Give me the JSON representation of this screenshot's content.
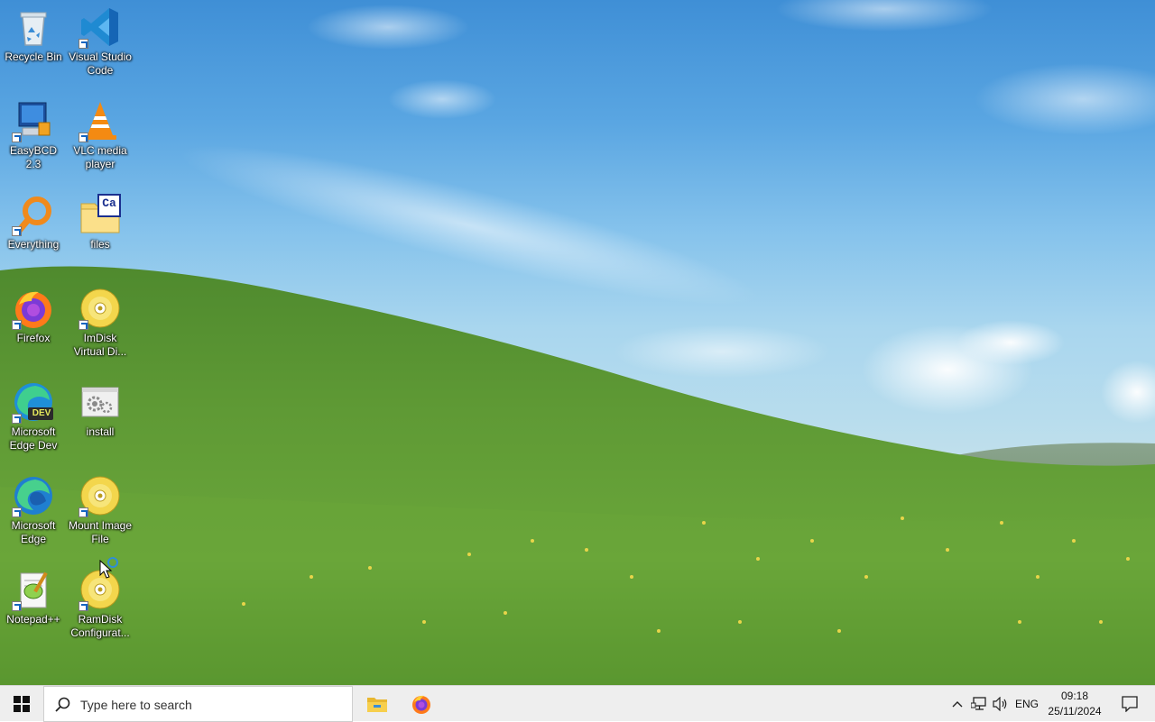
{
  "desktop": {
    "icons": [
      {
        "label": "Recycle Bin",
        "icon": "recycle-bin-icon"
      },
      {
        "label": "Visual Studio Code",
        "icon": "vscode-icon"
      },
      {
        "label": "EasyBCD 2.3",
        "icon": "easybcd-icon"
      },
      {
        "label": "VLC media player",
        "icon": "vlc-icon"
      },
      {
        "label": "Everything",
        "icon": "everything-search-icon"
      },
      {
        "label": "files",
        "icon": "folder-icon"
      },
      {
        "label": "Firefox",
        "icon": "firefox-icon"
      },
      {
        "label": "ImDisk Virtual Di...",
        "icon": "disc-icon"
      },
      {
        "label": "Microsoft Edge Dev",
        "icon": "edge-dev-icon"
      },
      {
        "label": "install",
        "icon": "settings-file-icon"
      },
      {
        "label": "Microsoft Edge",
        "icon": "edge-icon"
      },
      {
        "label": "Mount Image File",
        "icon": "disc-icon"
      },
      {
        "label": "Notepad++",
        "icon": "notepadpp-icon"
      },
      {
        "label": "RamDisk Configurat...",
        "icon": "disc-icon"
      }
    ],
    "edge_dev_badge": "DEV",
    "folder_badge": "Ca"
  },
  "taskbar": {
    "search_placeholder": "Type here to search",
    "pinned": [
      {
        "name": "File Explorer",
        "icon": "file-explorer-icon"
      },
      {
        "name": "Firefox",
        "icon": "firefox-icon"
      }
    ],
    "tray": {
      "language": "ENG",
      "time": "09:18",
      "date": "25/11/2024"
    }
  },
  "colors": {
    "taskbar_bg": "#eeeeee",
    "sky_top": "#3f8fd6",
    "grass": "#5f9a33"
  }
}
